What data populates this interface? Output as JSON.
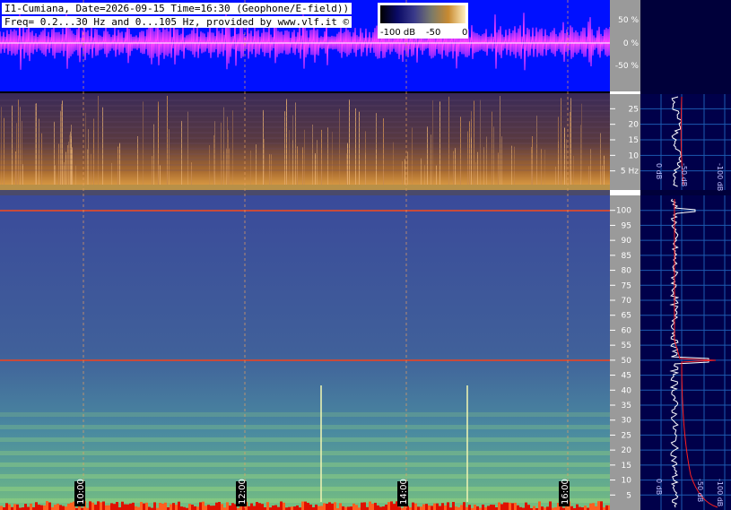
{
  "header": {
    "line1": "I1-Cumiana, Date=2026-09-15 Time=16:30 (Geophone/E-field))",
    "line2": "Freq= 0.2...30 Hz and 0...105 Hz, provided by www.vlf.it ©"
  },
  "colorbar": {
    "labels": [
      "-100 dB",
      "-50",
      "0"
    ]
  },
  "chart_data": [
    {
      "type": "line",
      "panel": "waveform",
      "yticks": [
        "50 %",
        "0 %",
        "-50 %"
      ],
      "colors": {
        "background": "#0010ff",
        "trace": "#ff40ff",
        "center": "#ffffff"
      }
    },
    {
      "type": "heatmap",
      "panel": "spectrogram-low",
      "ylabel": "Hz",
      "ylim": [
        0,
        30
      ],
      "yticks": [
        5,
        10,
        15,
        20,
        25
      ],
      "tick_labels": [
        "5 Hz",
        "10",
        "15",
        "20",
        "25"
      ],
      "spectrum_labels": [
        "0 dB",
        "-50 dB",
        "-100 dB"
      ]
    },
    {
      "type": "heatmap",
      "panel": "spectrogram-high",
      "ylim": [
        0,
        105
      ],
      "yticks": [
        5,
        10,
        15,
        20,
        25,
        30,
        35,
        40,
        45,
        50,
        55,
        60,
        65,
        70,
        75,
        80,
        85,
        90,
        95,
        100
      ],
      "time_labels": [
        "10:00",
        "12:00",
        "14:00",
        "16:00"
      ],
      "spectrum_labels": [
        "0 dB",
        "-50 dB",
        "-100 dB"
      ],
      "marker_lines_hz": [
        50,
        100
      ]
    }
  ]
}
